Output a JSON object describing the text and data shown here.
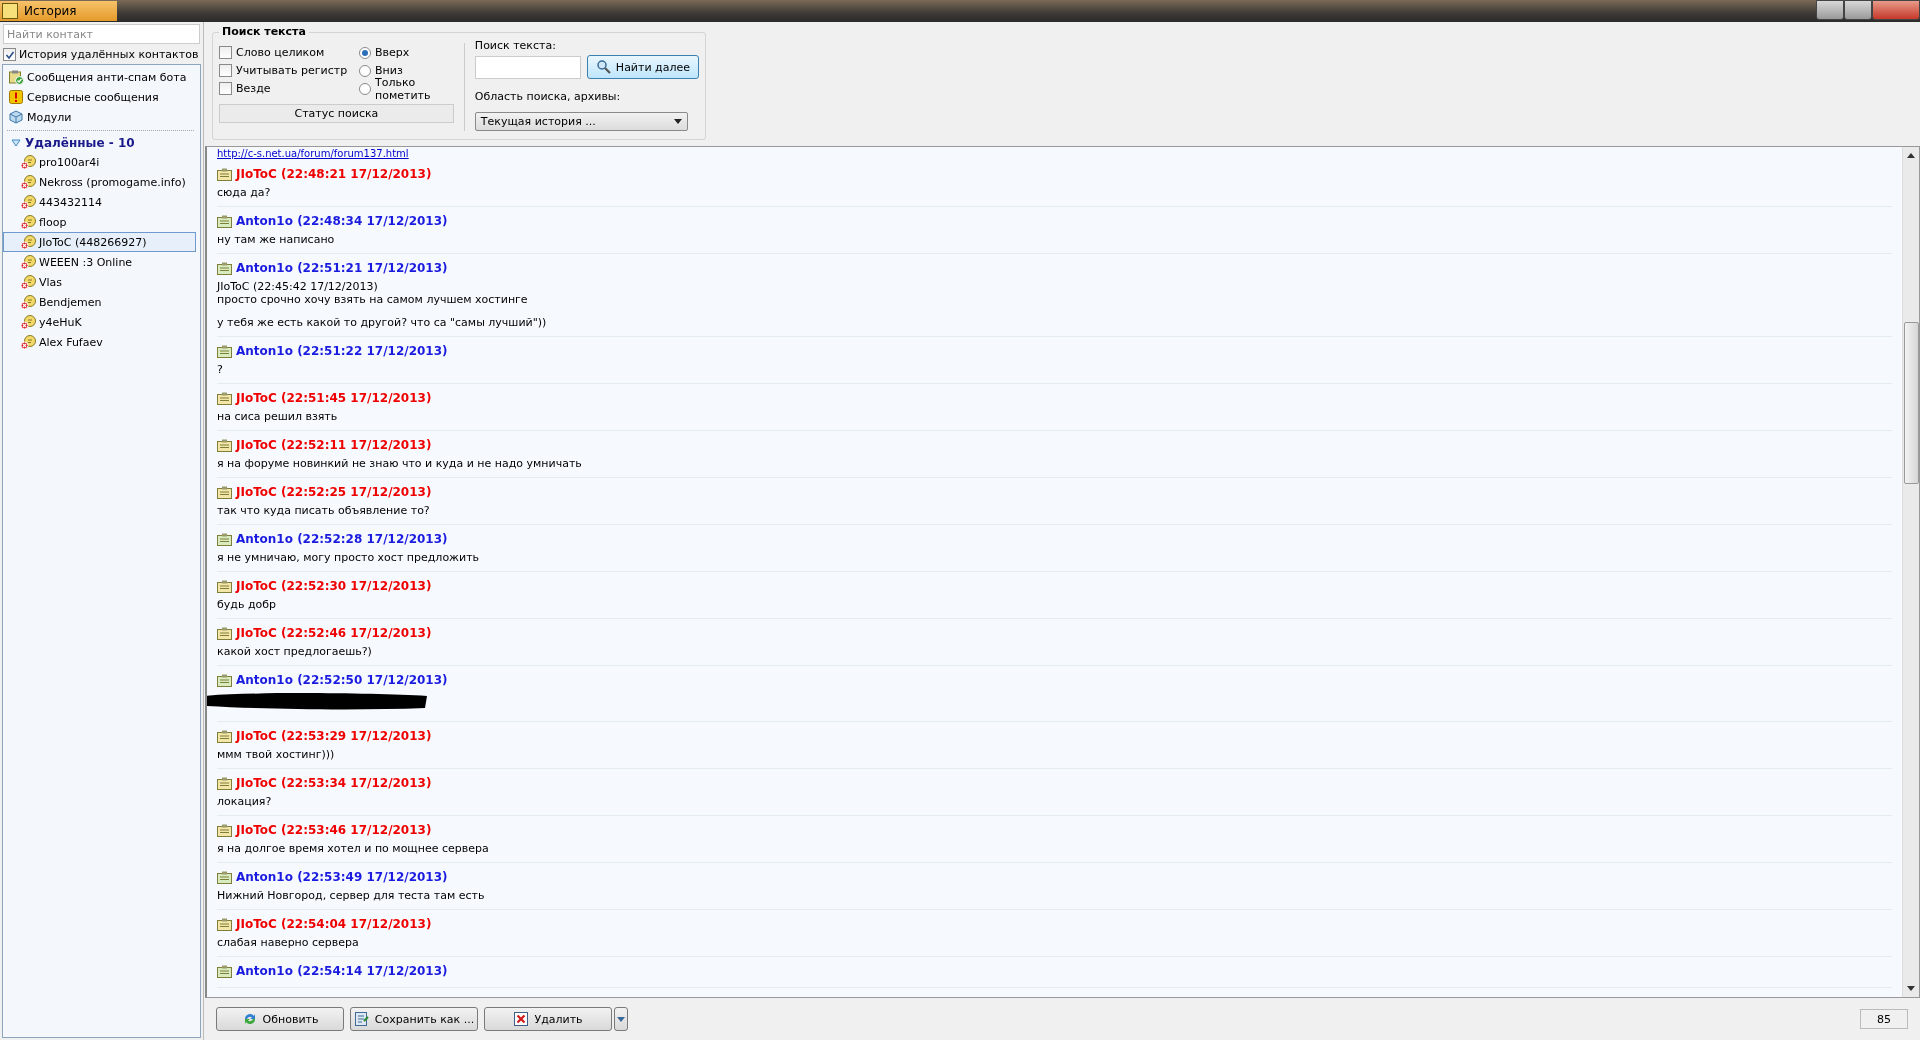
{
  "window": {
    "title": "История"
  },
  "sidebar": {
    "search": {
      "placeholder": "Найти контакт"
    },
    "deleted_history": {
      "label": "История удалённых контактов",
      "checked": true
    },
    "items": [
      {
        "label": "Сообщения анти-спам бота",
        "kind": "antispam"
      },
      {
        "label": "Сервисные сообщения",
        "kind": "service"
      },
      {
        "label": "Модули",
        "kind": "modules"
      }
    ],
    "group": {
      "label": "Удалённые - 10",
      "expanded": true,
      "contacts": [
        {
          "name": "pro100ar4i",
          "selected": false
        },
        {
          "name": "Nekross (promogame.info)",
          "selected": false
        },
        {
          "name": "443432114",
          "selected": false
        },
        {
          "name": "floop",
          "selected": false
        },
        {
          "name": "JIoToC (448266927)",
          "selected": true
        },
        {
          "name": "WEEEN :3 Online",
          "selected": false
        },
        {
          "name": "Vlas",
          "selected": false
        },
        {
          "name": "Bendjemen",
          "selected": false
        },
        {
          "name": "y4eHuK",
          "selected": false
        },
        {
          "name": "Alex Fufaev",
          "selected": false
        }
      ]
    }
  },
  "search_panel": {
    "title": "Поиск текста",
    "options": [
      {
        "label": "Слово целиком",
        "checked": false
      },
      {
        "label": "Учитывать регистр",
        "checked": false
      },
      {
        "label": "Везде",
        "checked": false
      }
    ],
    "directions": [
      {
        "label": "Вверх",
        "selected": true
      },
      {
        "label": "Вниз",
        "selected": false
      },
      {
        "label": "Только пометить",
        "selected": false
      }
    ],
    "status": "Статус поиска",
    "text_label": "Поиск текста:",
    "find_button": "Найти далее",
    "scope_label": "Область поиска, архивы:",
    "scope_value": "Текущая история ..."
  },
  "history": {
    "link": "http://c-s.net.ua/forum/forum137.html",
    "messages": [
      {
        "kind": "incoming",
        "header": "JIoToC (22:48:21 17/12/2013)",
        "paragraphs": [
          "сюда да?"
        ]
      },
      {
        "kind": "outgoing",
        "header": "Anton1o (22:48:34 17/12/2013)",
        "paragraphs": [
          "ну там же написано"
        ]
      },
      {
        "kind": "outgoing",
        "header": "Anton1o (22:51:21 17/12/2013)",
        "paragraphs": [
          " JIoToC (22:45:42 17/12/2013)\nпросто срочно хочу взять на самом лучшем хостинге",
          "у тебя же есть какой то другой? что са \"самы лучший\"))"
        ]
      },
      {
        "kind": "outgoing",
        "header": "Anton1o (22:51:22 17/12/2013)",
        "paragraphs": [
          "?"
        ]
      },
      {
        "kind": "incoming",
        "header": "JIoToC (22:51:45 17/12/2013)",
        "paragraphs": [
          "на сиса решил взять"
        ]
      },
      {
        "kind": "incoming",
        "header": "JIoToC (22:52:11 17/12/2013)",
        "paragraphs": [
          "я на форуме новинкий не знаю что и куда и не надо умничать"
        ]
      },
      {
        "kind": "incoming",
        "header": "JIoToC (22:52:25 17/12/2013)",
        "paragraphs": [
          "так что куда писать объявление то?"
        ]
      },
      {
        "kind": "outgoing",
        "header": "Anton1o (22:52:28 17/12/2013)",
        "paragraphs": [
          "я не умничаю, могу просто хост предложить"
        ]
      },
      {
        "kind": "incoming",
        "header": "JIoToC (22:52:30 17/12/2013)",
        "paragraphs": [
          "будь добр"
        ]
      },
      {
        "kind": "incoming",
        "header": "JIoToC (22:52:46 17/12/2013)",
        "paragraphs": [
          "какой хост предлогаешь?)"
        ]
      },
      {
        "kind": "outgoing",
        "header": "Anton1o (22:52:50 17/12/2013)",
        "redacted": true
      },
      {
        "kind": "incoming",
        "header": "JIoToC (22:53:29 17/12/2013)",
        "paragraphs": [
          "ммм твой хостинг)))"
        ]
      },
      {
        "kind": "incoming",
        "header": "JIoToC (22:53:34 17/12/2013)",
        "paragraphs": [
          "локация?"
        ]
      },
      {
        "kind": "incoming",
        "header": "JIoToC (22:53:46 17/12/2013)",
        "paragraphs": [
          "я на долгое время хотел и по мощнее сервера"
        ]
      },
      {
        "kind": "outgoing",
        "header": "Anton1o (22:53:49 17/12/2013)",
        "paragraphs": [
          "Нижний Новгород, сервер для теста там есть"
        ]
      },
      {
        "kind": "incoming",
        "header": "JIoToC (22:54:04 17/12/2013)",
        "paragraphs": [
          "слабая наверно сервера"
        ]
      },
      {
        "kind": "outgoing",
        "header": "Anton1o (22:54:14 17/12/2013)"
      }
    ]
  },
  "buttons": [
    {
      "label": "Обновить",
      "kind": "refresh"
    },
    {
      "label": "Сохранить как ...",
      "kind": "save"
    },
    {
      "label": "Удалить",
      "kind": "delete"
    }
  ],
  "status_count": "85"
}
